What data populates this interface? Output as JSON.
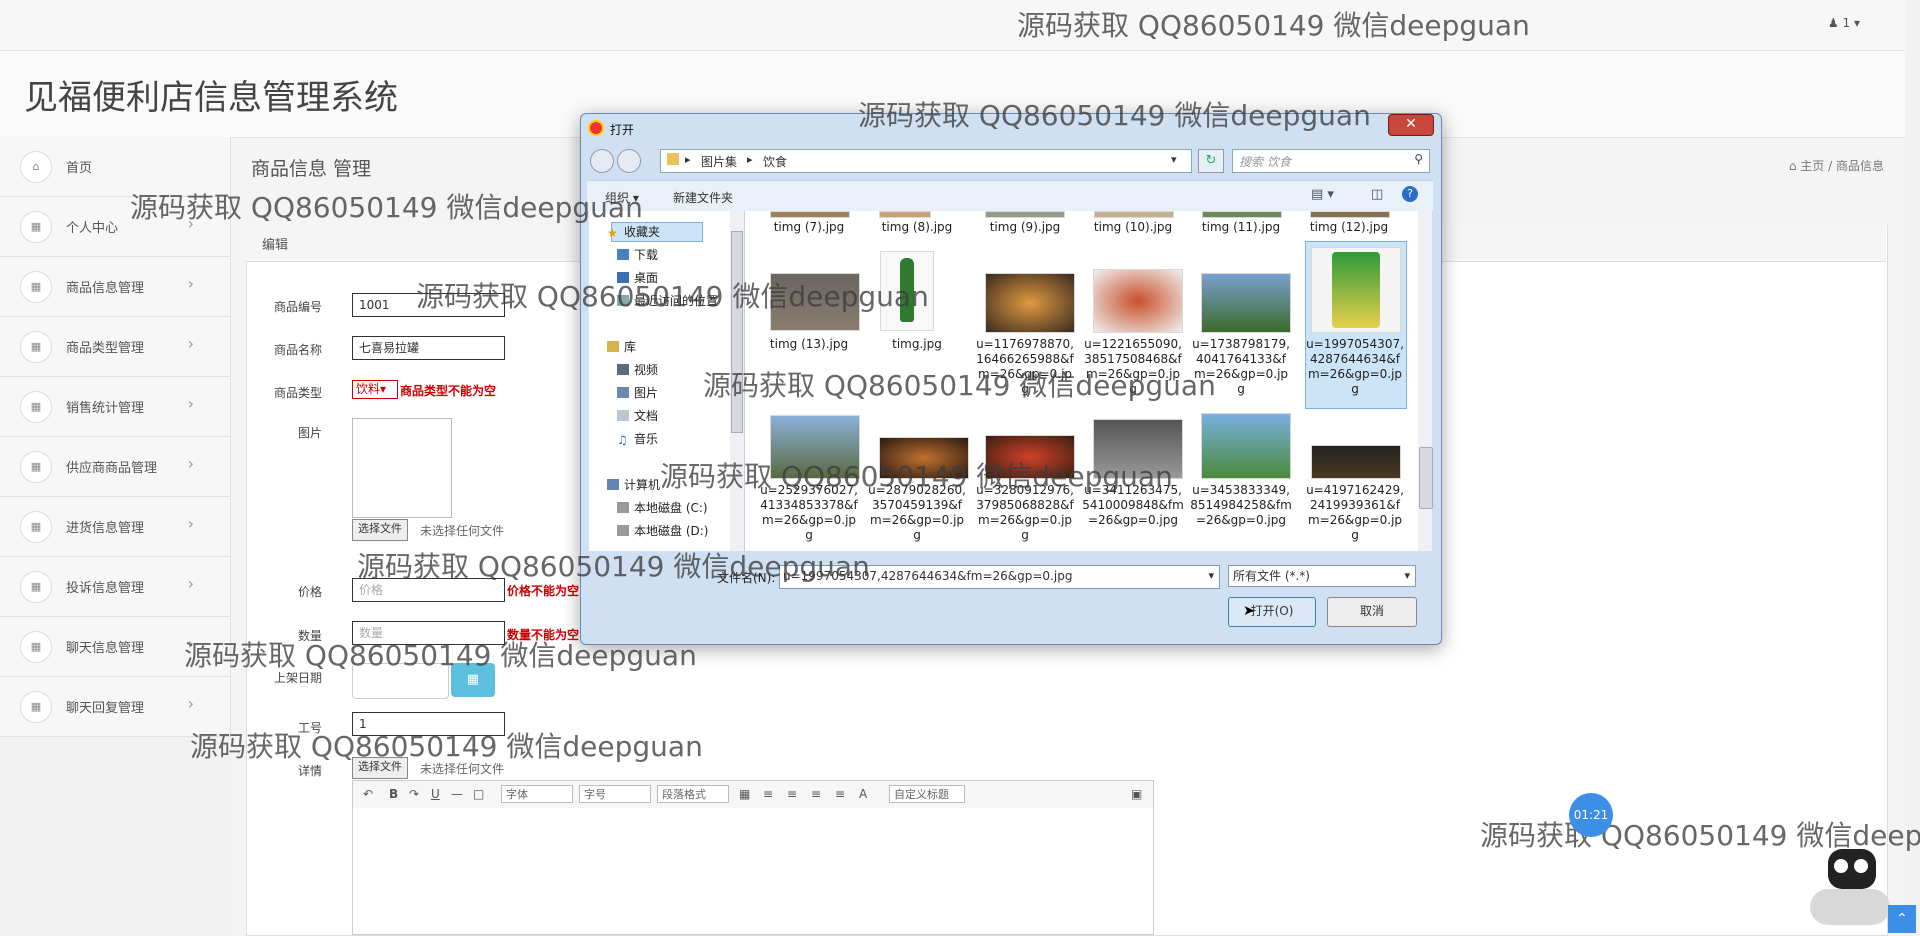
{
  "topbar": {
    "user_label": "1"
  },
  "app": {
    "title": "见福便利店信息管理系统"
  },
  "sidebar": {
    "items": [
      {
        "label": "首页"
      },
      {
        "label": "个人中心"
      },
      {
        "label": "商品信息管理"
      },
      {
        "label": "商品类型管理"
      },
      {
        "label": "销售统计管理"
      },
      {
        "label": "供应商商品管理"
      },
      {
        "label": "进货信息管理"
      },
      {
        "label": "投诉信息管理"
      },
      {
        "label": "聊天信息管理"
      },
      {
        "label": "聊天回复管理"
      }
    ]
  },
  "page": {
    "heading": "商品信息 管理",
    "breadcrumb": {
      "home": "主页",
      "sep": "/",
      "current": "商品信息"
    },
    "panel_title": "编辑"
  },
  "form": {
    "code": {
      "label": "商品编号",
      "value": "1001"
    },
    "name": {
      "label": "商品名称",
      "value": "七喜易拉罐"
    },
    "type": {
      "label": "商品类型",
      "value": "饮料",
      "error": "商品类型不能为空"
    },
    "image": {
      "label": "图片",
      "button": "选择文件",
      "status": "未选择任何文件"
    },
    "price": {
      "label": "价格",
      "placeholder": "价格",
      "error": "价格不能为空"
    },
    "qty": {
      "label": "数量",
      "placeholder": "数量",
      "error": "数量不能为空"
    },
    "shelf_date": {
      "label": "上架日期"
    },
    "worker": {
      "label": "工号",
      "value": "1"
    },
    "detail": {
      "label": "详情",
      "button": "选择文件",
      "status": "未选择任何文件"
    }
  },
  "editor": {
    "font": "字体",
    "size": "字号",
    "paragraph": "段落格式",
    "custom_title": "自定义标题"
  },
  "dialog": {
    "title": "打开",
    "path": [
      "图片集",
      "饮食"
    ],
    "search_placeholder": "搜索 饮食",
    "organize": "组织 ▾",
    "new_folder": "新建文件夹",
    "nav": {
      "favorites": "收藏夹",
      "downloads": "下载",
      "desktop": "桌面",
      "recent": "最近访问的位置",
      "libraries": "库",
      "videos": "视频",
      "pictures": "图片",
      "documents": "文档",
      "music": "音乐",
      "computer": "计算机",
      "drive_c": "本地磁盘 (C:)",
      "drive_d": "本地磁盘 (D:)"
    },
    "files_row1": [
      "timg (7).jpg",
      "timg (8).jpg",
      "timg (9).jpg",
      "timg (10).jpg",
      "timg (11).jpg",
      "timg (12).jpg"
    ],
    "files_row2": [
      [
        "timg (13).jpg"
      ],
      [
        "timg.jpg"
      ],
      [
        "u=1176978870,",
        "16466265988&f",
        "m=26&gp=0.jp",
        "g"
      ],
      [
        "u=1221655090,",
        "38517508468&f",
        "m=26&gp=0.jp",
        "g"
      ],
      [
        "u=1738798179,",
        "4041764133&f",
        "m=26&gp=0.jp",
        "g"
      ],
      [
        "u=1997054307,",
        "4287644634&f",
        "m=26&gp=0.jp",
        "g"
      ]
    ],
    "files_row3": [
      [
        "u=2529376027,",
        "41334853378&f",
        "m=26&gp=0.jp",
        "g"
      ],
      [
        "u=2879028260,",
        "3570459139&f",
        "m=26&gp=0.jp",
        "g"
      ],
      [
        "u=3280912976,",
        "37985068828&f",
        "m=26&gp=0.jp",
        "g"
      ],
      [
        "u=3411263475,",
        "5410009848&fm",
        "=26&gp=0.jpg"
      ],
      [
        "u=3453833349,",
        "8514984258&fm",
        "=26&gp=0.jpg"
      ],
      [
        "u=4197162429,",
        "2419939361&f",
        "m=26&gp=0.jp",
        "g"
      ]
    ],
    "filename_label": "文件名(N):",
    "filename_value": "u=1997054307,4287644634&fm=26&gp=0.jpg",
    "filetype": "所有文件 (*.*)",
    "open_button": "打开(O)",
    "cancel_button": "取消"
  },
  "watermark": "源码获取 QQ86050149 微信deepguan",
  "clock": "01:21",
  "colors": {
    "accent": "#3d8ee6",
    "error": "#cc0000",
    "date_button": "#5bc0de"
  }
}
